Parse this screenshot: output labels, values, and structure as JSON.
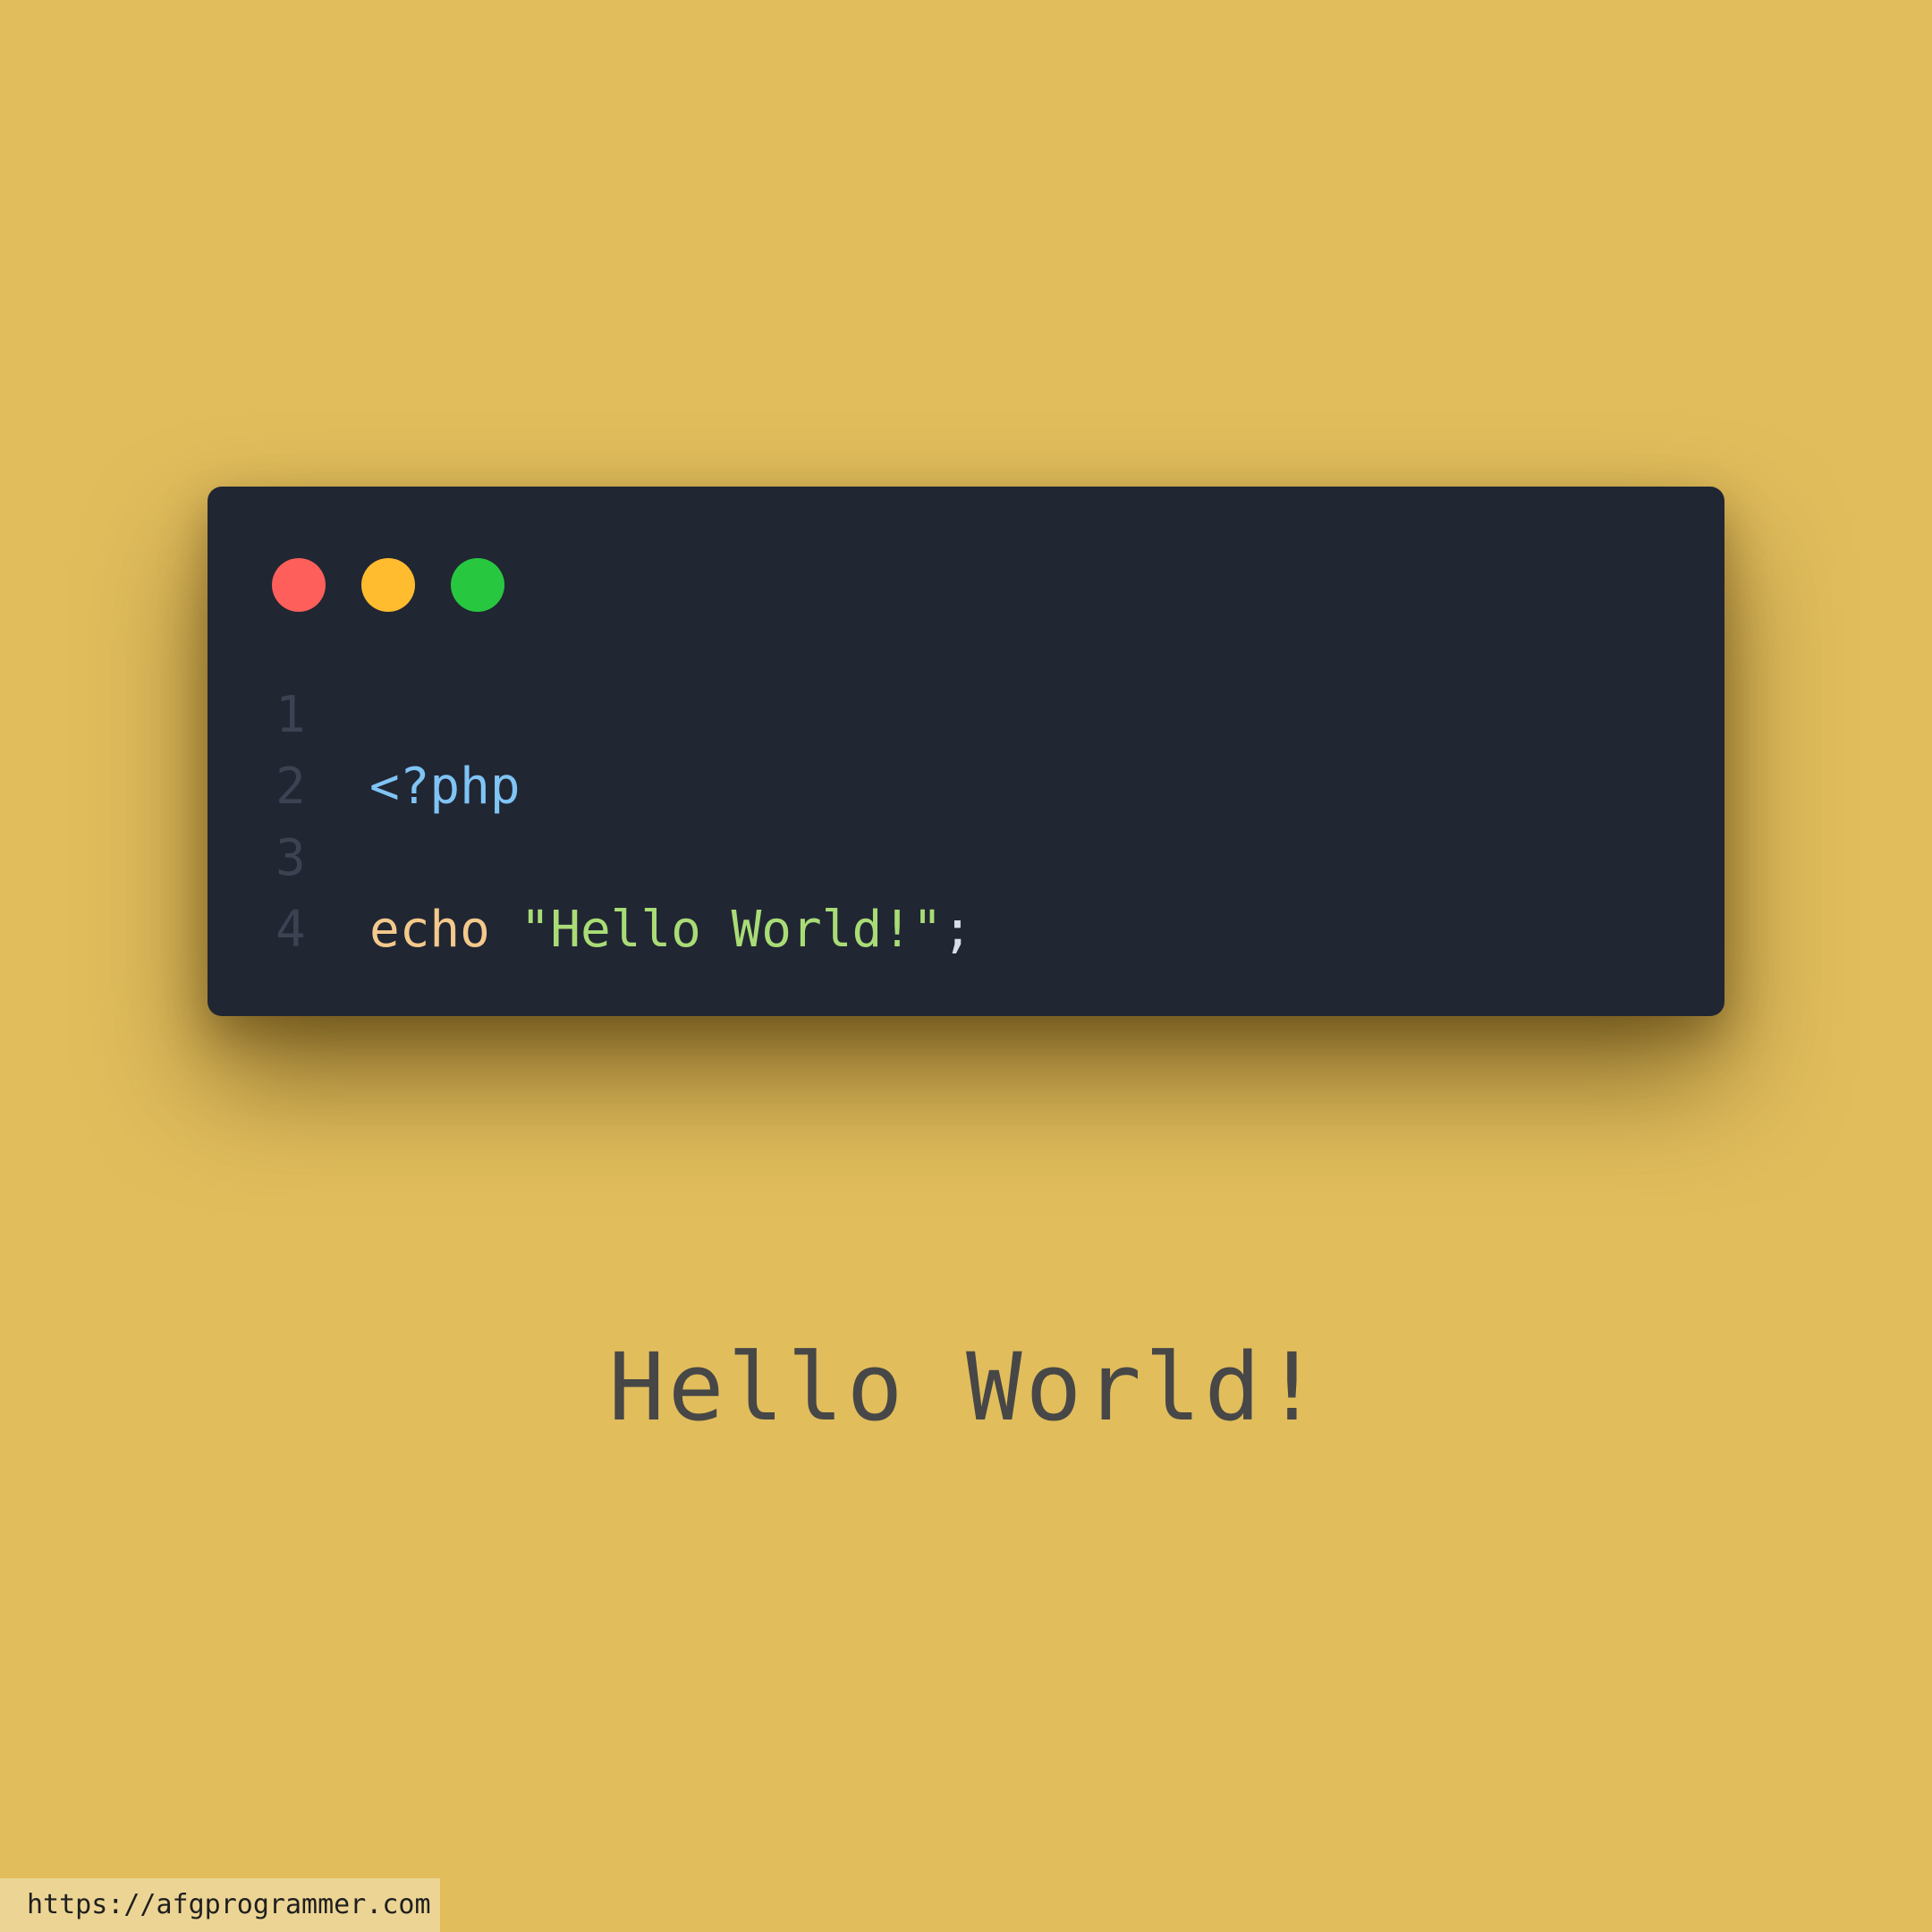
{
  "window": {
    "controls": [
      {
        "name": "close",
        "color": "#FF5F5A"
      },
      {
        "name": "minimize",
        "color": "#FEBC2E"
      },
      {
        "name": "maximize",
        "color": "#27C840"
      }
    ]
  },
  "code": {
    "lines": [
      {
        "number": "1",
        "tokens": [
          {
            "text": "<?php",
            "type": "tag"
          }
        ]
      },
      {
        "number": "2",
        "tokens": []
      },
      {
        "number": "3",
        "tokens": [
          {
            "text": "echo",
            "type": "keyword"
          },
          {
            "text": " ",
            "type": "space"
          },
          {
            "text": "\"Hello World!\"",
            "type": "string"
          },
          {
            "text": ";",
            "type": "punct"
          }
        ]
      },
      {
        "number": "4",
        "tokens": []
      }
    ],
    "colors": {
      "background": "#212633",
      "line_number": "#3B4252",
      "tag": "#7FC4F5",
      "keyword": "#F4C98C",
      "string": "#A9DC76",
      "punct": "#D8DEE9"
    }
  },
  "output": {
    "text": "Hello World!"
  },
  "footer": {
    "url": "https://afgprogrammer.com"
  },
  "page": {
    "background": "#E1BD5C"
  }
}
